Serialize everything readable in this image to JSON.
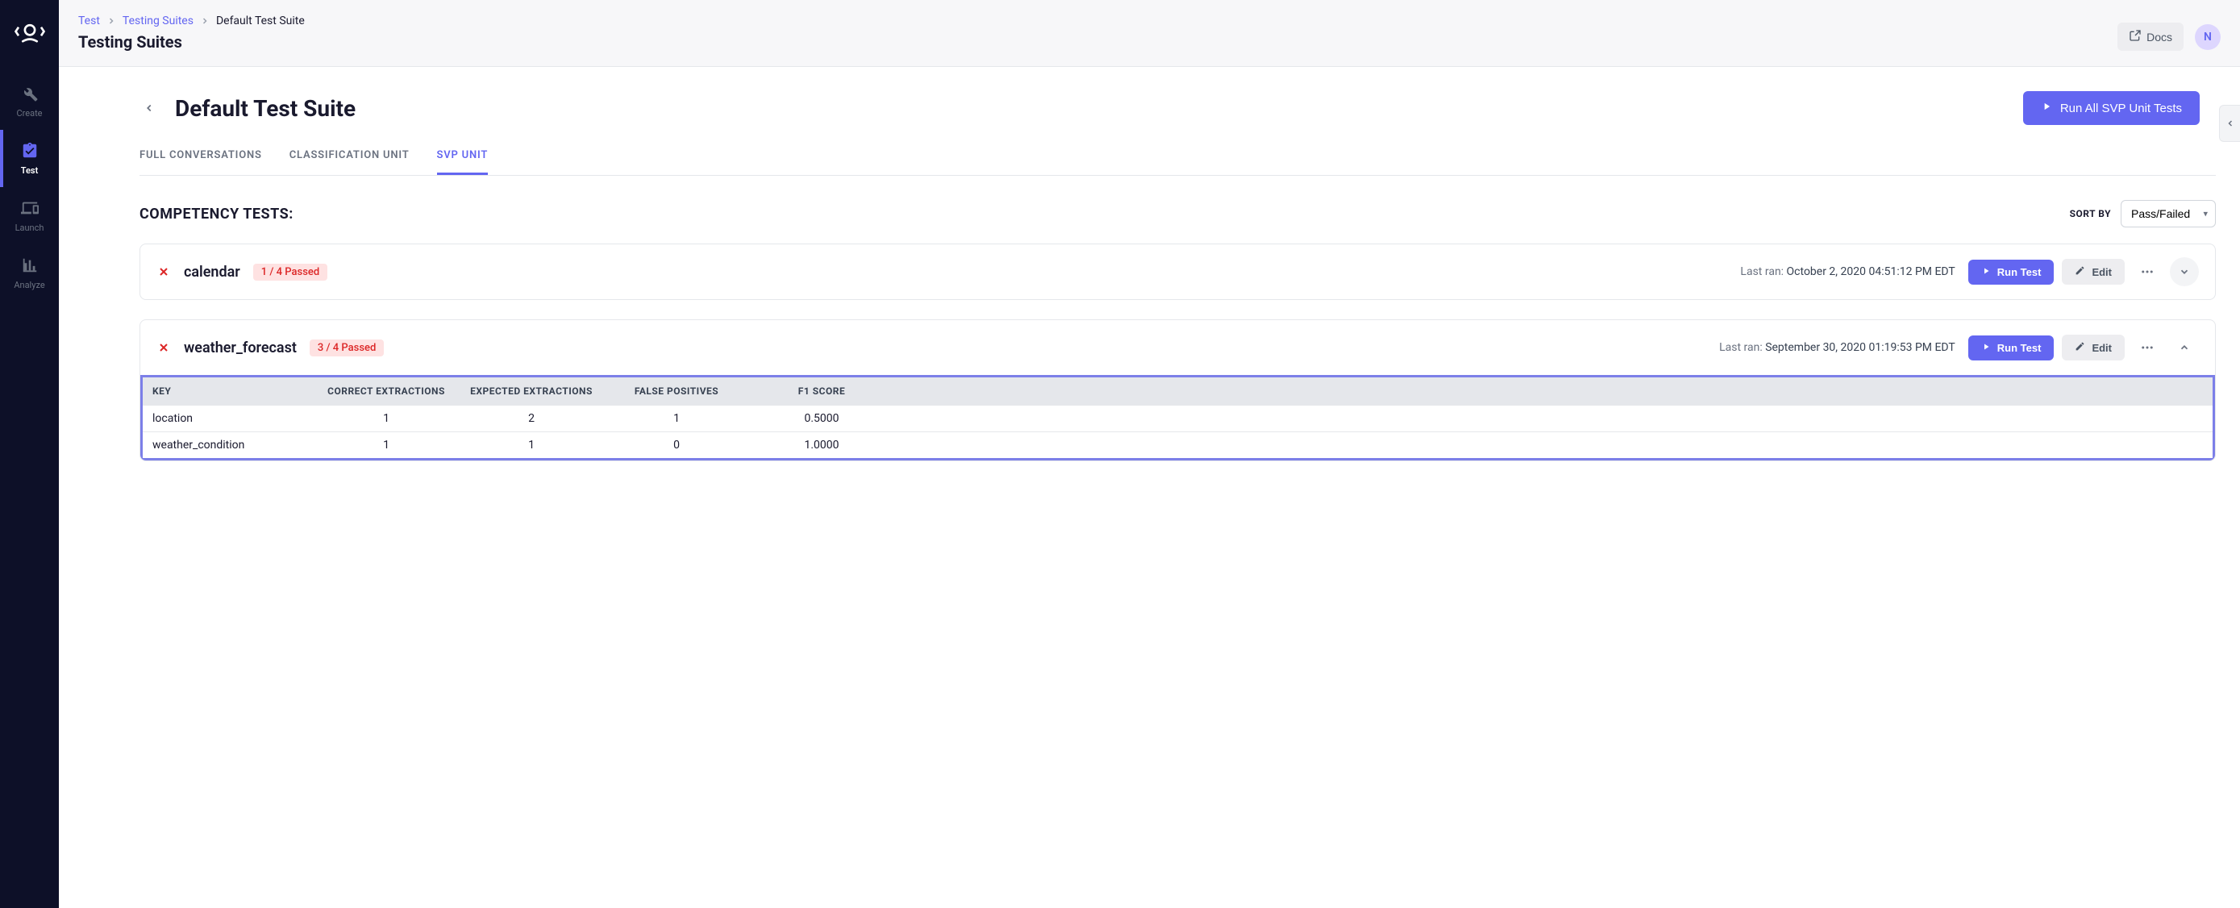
{
  "sidebar": {
    "items": [
      {
        "label": "Create"
      },
      {
        "label": "Test"
      },
      {
        "label": "Launch"
      },
      {
        "label": "Analyze"
      }
    ]
  },
  "header": {
    "breadcrumb": [
      {
        "label": "Test"
      },
      {
        "label": "Testing Suites"
      },
      {
        "label": "Default Test Suite"
      }
    ],
    "title": "Testing Suites",
    "docs_label": "Docs",
    "avatar_initial": "N"
  },
  "page": {
    "title": "Default Test Suite",
    "run_all_label": "Run All SVP Unit Tests"
  },
  "tabs": [
    {
      "label": "FULL CONVERSATIONS"
    },
    {
      "label": "CLASSIFICATION UNIT"
    },
    {
      "label": "SVP UNIT"
    }
  ],
  "section": {
    "title": "COMPETENCY TESTS:",
    "sort_label": "SORT BY",
    "sort_value": "Pass/Failed"
  },
  "tests": [
    {
      "name": "calendar",
      "badge": "1 / 4 Passed",
      "last_ran_label": "Last ran: ",
      "last_ran_value": "October 2, 2020 04:51:12 PM EDT",
      "run_label": "Run Test",
      "edit_label": "Edit"
    },
    {
      "name": "weather_forecast",
      "badge": "3 / 4 Passed",
      "last_ran_label": "Last ran: ",
      "last_ran_value": "September 30, 2020 01:19:53 PM EDT",
      "run_label": "Run Test",
      "edit_label": "Edit",
      "results": {
        "columns": [
          "KEY",
          "CORRECT EXTRACTIONS",
          "EXPECTED EXTRACTIONS",
          "FALSE POSITIVES",
          "F1 SCORE"
        ],
        "rows": [
          {
            "key": "location",
            "correct": "1",
            "expected": "2",
            "fp": "1",
            "f1": "0.5000"
          },
          {
            "key": "weather_condition",
            "correct": "1",
            "expected": "1",
            "fp": "0",
            "f1": "1.0000"
          }
        ]
      }
    }
  ]
}
